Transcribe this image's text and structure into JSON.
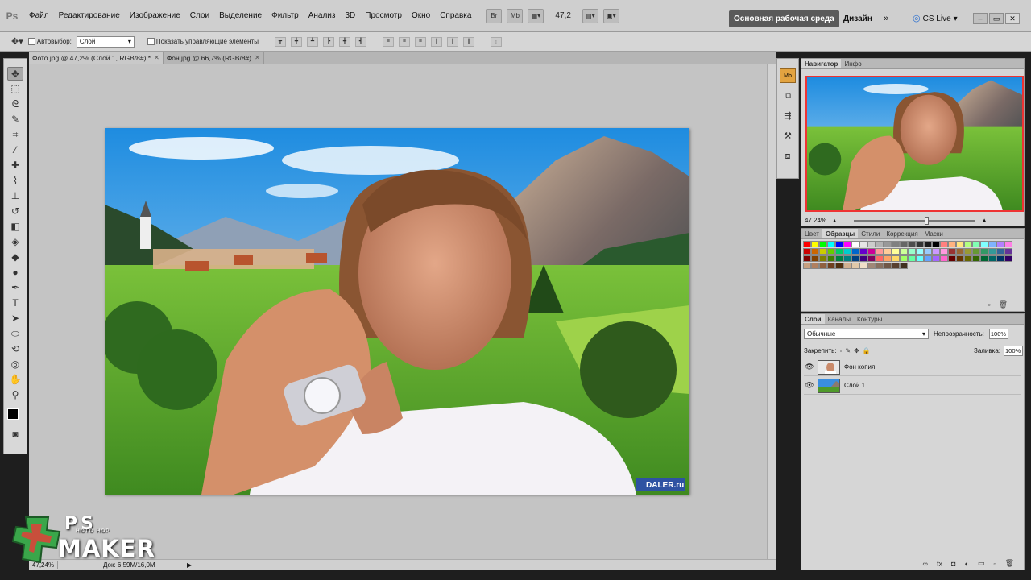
{
  "app": {
    "logo": "Ps"
  },
  "menu": [
    "Файл",
    "Редактирование",
    "Изображение",
    "Слои",
    "Выделение",
    "Фильтр",
    "Анализ",
    "3D",
    "Просмотр",
    "Окно",
    "Справка"
  ],
  "menu_tools": {
    "br": "Br",
    "mb": "Mb",
    "zoom": "47,2"
  },
  "workspace": {
    "active": "Основная рабочая среда",
    "design": "Дизайн",
    "more": "»",
    "cslive": "CS Live"
  },
  "options": {
    "autoselect_label": "Автовыбор:",
    "autoselect_value": "Слой",
    "show_controls_label": "Показать управляющие элементы"
  },
  "tabs": [
    {
      "label": "Фото.jpg @ 47,2% (Слой 1, RGB/8#) *"
    },
    {
      "label": "Фон.jpg @ 66,7% (RGB/8#)"
    }
  ],
  "canvas": {
    "watermark": "DALER.ru"
  },
  "status": {
    "zoom": "47,24%",
    "doc": "Док: 6,59M/16,0M"
  },
  "navigator": {
    "tabs": [
      "Навигатор",
      "Инфо"
    ],
    "zoom": "47.24%"
  },
  "swatches": {
    "tabs": [
      "Цвет",
      "Образцы",
      "Стили",
      "Коррекция",
      "Маски"
    ],
    "colors": [
      "#ff0000",
      "#ffff00",
      "#00ff00",
      "#00ffff",
      "#0000ff",
      "#ff00ff",
      "#ffffff",
      "#e6e6e6",
      "#cccccc",
      "#b3b3b3",
      "#999999",
      "#808080",
      "#666666",
      "#4d4d4d",
      "#333333",
      "#1a1a1a",
      "#000000",
      "#ff8080",
      "#ffb380",
      "#ffe680",
      "#b3ff80",
      "#80ffb3",
      "#80ffff",
      "#80b3ff",
      "#b380ff",
      "#ff80e6",
      "#cc0000",
      "#cc6600",
      "#cccc00",
      "#66cc00",
      "#00cc66",
      "#00cccc",
      "#0066cc",
      "#6600cc",
      "#cc0099",
      "#ff9999",
      "#ffcc99",
      "#ffff99",
      "#ccff99",
      "#99ffcc",
      "#99ffff",
      "#99ccff",
      "#cc99ff",
      "#ff99dd",
      "#993333",
      "#996633",
      "#999933",
      "#669933",
      "#339966",
      "#339999",
      "#336699",
      "#663399",
      "#800000",
      "#804000",
      "#808000",
      "#408000",
      "#008040",
      "#008080",
      "#004080",
      "#400080",
      "#800060",
      "#ff6666",
      "#ffa366",
      "#ffd966",
      "#a3ff66",
      "#66ffa3",
      "#66ffff",
      "#66a3ff",
      "#a366ff",
      "#ff66cc",
      "#660000",
      "#663300",
      "#666600",
      "#336600",
      "#006633",
      "#006666",
      "#003366",
      "#330066",
      "#c8a080",
      "#b08060",
      "#906040",
      "#704020",
      "#503010",
      "#d0b090",
      "#e0c8a8",
      "#f0e0c8",
      "#a08878",
      "#887060",
      "#705848",
      "#584030",
      "#403020"
    ],
    "new_icon": "new-swatch-icon",
    "delete_icon": "trash-icon"
  },
  "layers": {
    "tabs": [
      "Слои",
      "Каналы",
      "Контуры"
    ],
    "blend_mode": "Обычные",
    "opacity_label": "Непрозрачность:",
    "opacity": "100%",
    "lock_label": "Закрепить:",
    "fill_label": "Заливка:",
    "fill": "100%",
    "items": [
      {
        "name": "Фон копия"
      },
      {
        "name": "Слой 1"
      }
    ]
  },
  "watermark": {
    "ps": "PS",
    "sub": "HOTO HOP",
    "maker": "MAKER"
  }
}
